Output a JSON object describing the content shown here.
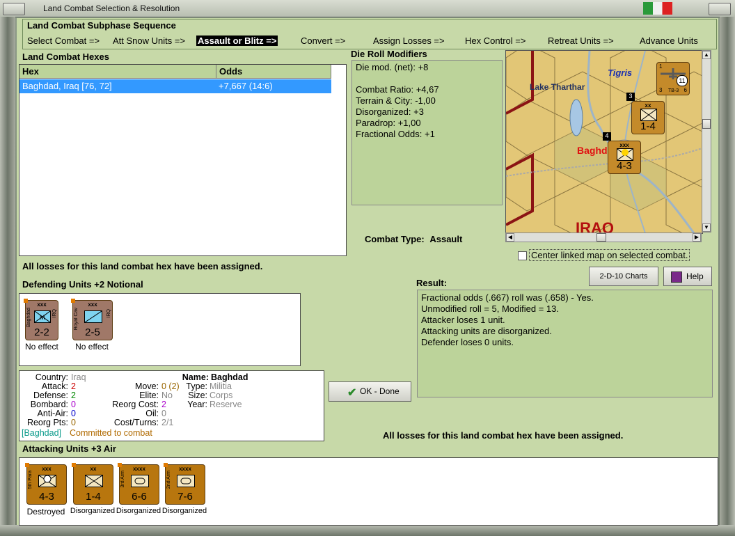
{
  "window": {
    "title": "Land Combat Selection & Resolution"
  },
  "subphase": {
    "header": "Land Combat Subphase Sequence",
    "steps": [
      "Select Combat =>",
      "Att Snow Units =>",
      "Assault or Blitz =>",
      "Convert =>",
      "Assign Losses =>",
      "Hex Control =>",
      "Retreat Units =>",
      "Advance Units"
    ],
    "active_step": "Assault or Blitz =>"
  },
  "hexes": {
    "header": "Land Combat Hexes",
    "columns": [
      "Hex",
      "Odds"
    ],
    "rows": [
      {
        "hex": "Baghdad, Iraq [76, 72]",
        "odds": "+7,667 (14:6)"
      }
    ]
  },
  "modifiers": {
    "header": "Die Roll Modifiers",
    "lines": [
      "Die mod. (net): +8",
      "",
      "Combat Ratio: +4,67",
      "Terrain & City: -1,00",
      "Disorganized: +3",
      "Paradrop: +1,00",
      "Fractional Odds: +1"
    ]
  },
  "map": {
    "labels": {
      "lake": "Lake Tharthar",
      "river": "Tigris",
      "city": "Baghd",
      "country": "IRAQ"
    },
    "units": [
      {
        "size": "xx",
        "strength": "1-4",
        "stack": "3"
      },
      {
        "size": "xxx",
        "strength": "4-3",
        "stack": "4"
      },
      {
        "type": "TB-3",
        "value": "11",
        "left": "3",
        "right": "6",
        "top": "1"
      }
    ],
    "center_linked_label": "Center linked map on selected combat.",
    "center_linked_checked": false
  },
  "combat_type": {
    "label": "Combat Type:",
    "value": "Assault"
  },
  "losses_msg": "All losses for this land combat hex have been assigned.",
  "defending": {
    "header": "Defending Units +2 Notional",
    "units": [
      {
        "name": "Baghdad",
        "size": "xxx",
        "nation": "IRQ",
        "strength": "2-2",
        "status": "No effect",
        "color": "#a07868"
      },
      {
        "name": "Royal Cav",
        "size": "xxx",
        "nation": "IRQ",
        "strength": "2-5",
        "status": "No effect",
        "color": "#a07868"
      }
    ]
  },
  "unit_info": {
    "country_label": "Country:",
    "country": "Iraq",
    "attack_label": "Attack:",
    "attack": "2",
    "defense_label": "Defense:",
    "defense": "2",
    "bombard_label": "Bombard:",
    "bombard": "0",
    "antiair_label": "Anti-Air:",
    "antiair": "0",
    "reorg_pts_label": "Reorg Pts:",
    "reorg_pts": "0",
    "name_label": "Name:",
    "name": "Baghdad",
    "move_label": "Move:",
    "move": "0 (2)",
    "elite_label": "Elite:",
    "elite": "No",
    "reorg_cost_label": "Reorg Cost:",
    "reorg_cost": "2",
    "oil_label": "Oil:",
    "oil": "0",
    "cost_turns_label": "Cost/Turns:",
    "cost_turns": "2/1",
    "type_label": "Type:",
    "type": "Militia",
    "size_label": "Size:",
    "size": "Corps",
    "year_label": "Year:",
    "year": "Reserve",
    "hex_tag": "[Baghdad]",
    "status": "Committed to combat"
  },
  "buttons": {
    "charts": "2-D-10 Charts",
    "help": "Help",
    "ok": "OK - Done"
  },
  "result": {
    "header": "Result:",
    "lines": [
      "Fractional odds (.667) roll was (.658)  - Yes.",
      "Unmodified roll = 5, Modified = 13.",
      "Attacker loses 1 unit.",
      "Attacking units are disorganized.",
      "Defender loses 0 units."
    ]
  },
  "attacking": {
    "header": "Attacking Units +3 Air",
    "units": [
      {
        "name": "5th Para",
        "size": "xxx",
        "strength": "4-3",
        "status": "Destroyed"
      },
      {
        "name": "",
        "size": "xx",
        "strength": "1-4",
        "status": "Disorganized"
      },
      {
        "name": "3rd Arm",
        "size": "xxxx",
        "strength": "6-6",
        "status": "Disorganized"
      },
      {
        "name": "2nd Arm",
        "size": "xxxx",
        "strength": "7-6",
        "status": "Disorganized"
      }
    ]
  },
  "colors": {
    "panel_bg": "#c7d9a8",
    "highlight": "#3399ff",
    "counter_brown": "#b8760e",
    "counter_iraq": "#a07868"
  }
}
